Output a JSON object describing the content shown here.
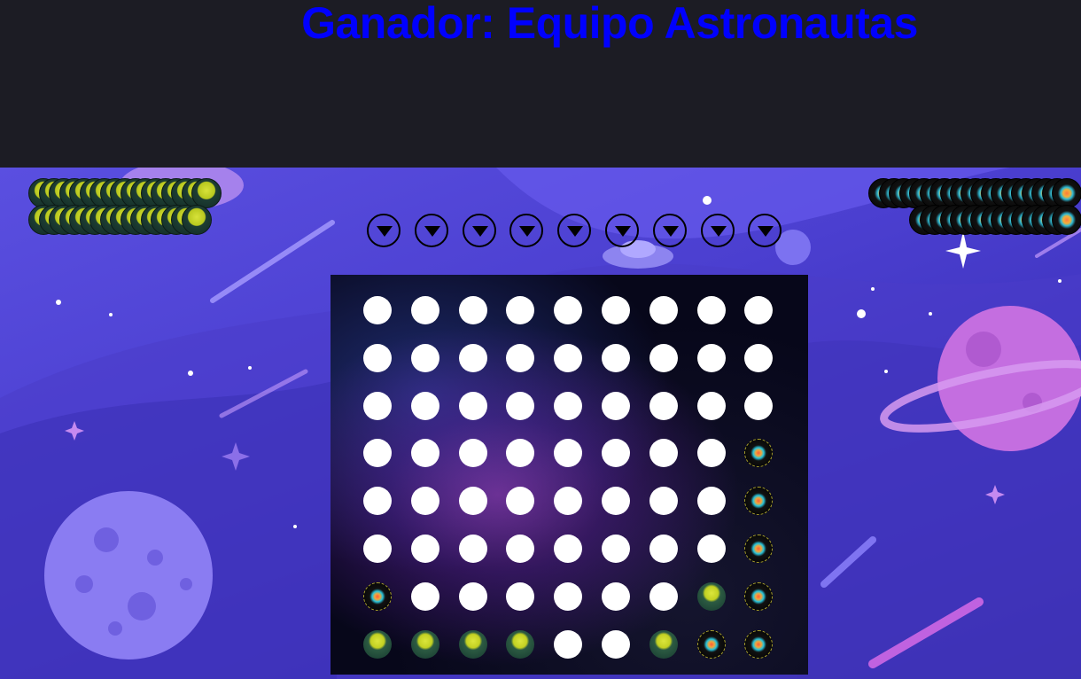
{
  "header": {
    "winner_text": "Ganador: Equipo Astronautas"
  },
  "colors": {
    "winner_text": "#0000ff",
    "header_bg": "#1c1c24",
    "empty_cell": "#ffffff"
  },
  "reserves": {
    "alien_team": {
      "piece": "alien-icon",
      "rows": [
        17,
        16
      ]
    },
    "astronaut_team": {
      "piece": "rocket-icon",
      "rows": [
        19,
        15
      ]
    }
  },
  "column_buttons": [
    {
      "icon": "chevron-down-icon"
    },
    {
      "icon": "chevron-down-icon"
    },
    {
      "icon": "chevron-down-icon"
    },
    {
      "icon": "chevron-down-icon"
    },
    {
      "icon": "chevron-down-icon"
    },
    {
      "icon": "chevron-down-icon"
    },
    {
      "icon": "chevron-down-icon"
    },
    {
      "icon": "chevron-down-icon"
    },
    {
      "icon": "chevron-down-icon"
    }
  ],
  "board": {
    "columns": 9,
    "rows": 8,
    "cells": [
      [
        "empty",
        "empty",
        "empty",
        "empty",
        "empty",
        "empty",
        "empty",
        "empty",
        "empty"
      ],
      [
        "empty",
        "empty",
        "empty",
        "empty",
        "empty",
        "empty",
        "empty",
        "empty",
        "empty"
      ],
      [
        "empty",
        "empty",
        "empty",
        "empty",
        "empty",
        "empty",
        "empty",
        "empty",
        "empty"
      ],
      [
        "empty",
        "empty",
        "empty",
        "empty",
        "empty",
        "empty",
        "empty",
        "empty",
        "rocket"
      ],
      [
        "empty",
        "empty",
        "empty",
        "empty",
        "empty",
        "empty",
        "empty",
        "empty",
        "rocket"
      ],
      [
        "empty",
        "empty",
        "empty",
        "empty",
        "empty",
        "empty",
        "empty",
        "empty",
        "rocket"
      ],
      [
        "rocket",
        "empty",
        "empty",
        "empty",
        "empty",
        "empty",
        "empty",
        "alien",
        "rocket"
      ],
      [
        "alien",
        "alien",
        "alien",
        "alien",
        "empty",
        "empty",
        "alien",
        "rocket",
        "rocket"
      ]
    ]
  }
}
